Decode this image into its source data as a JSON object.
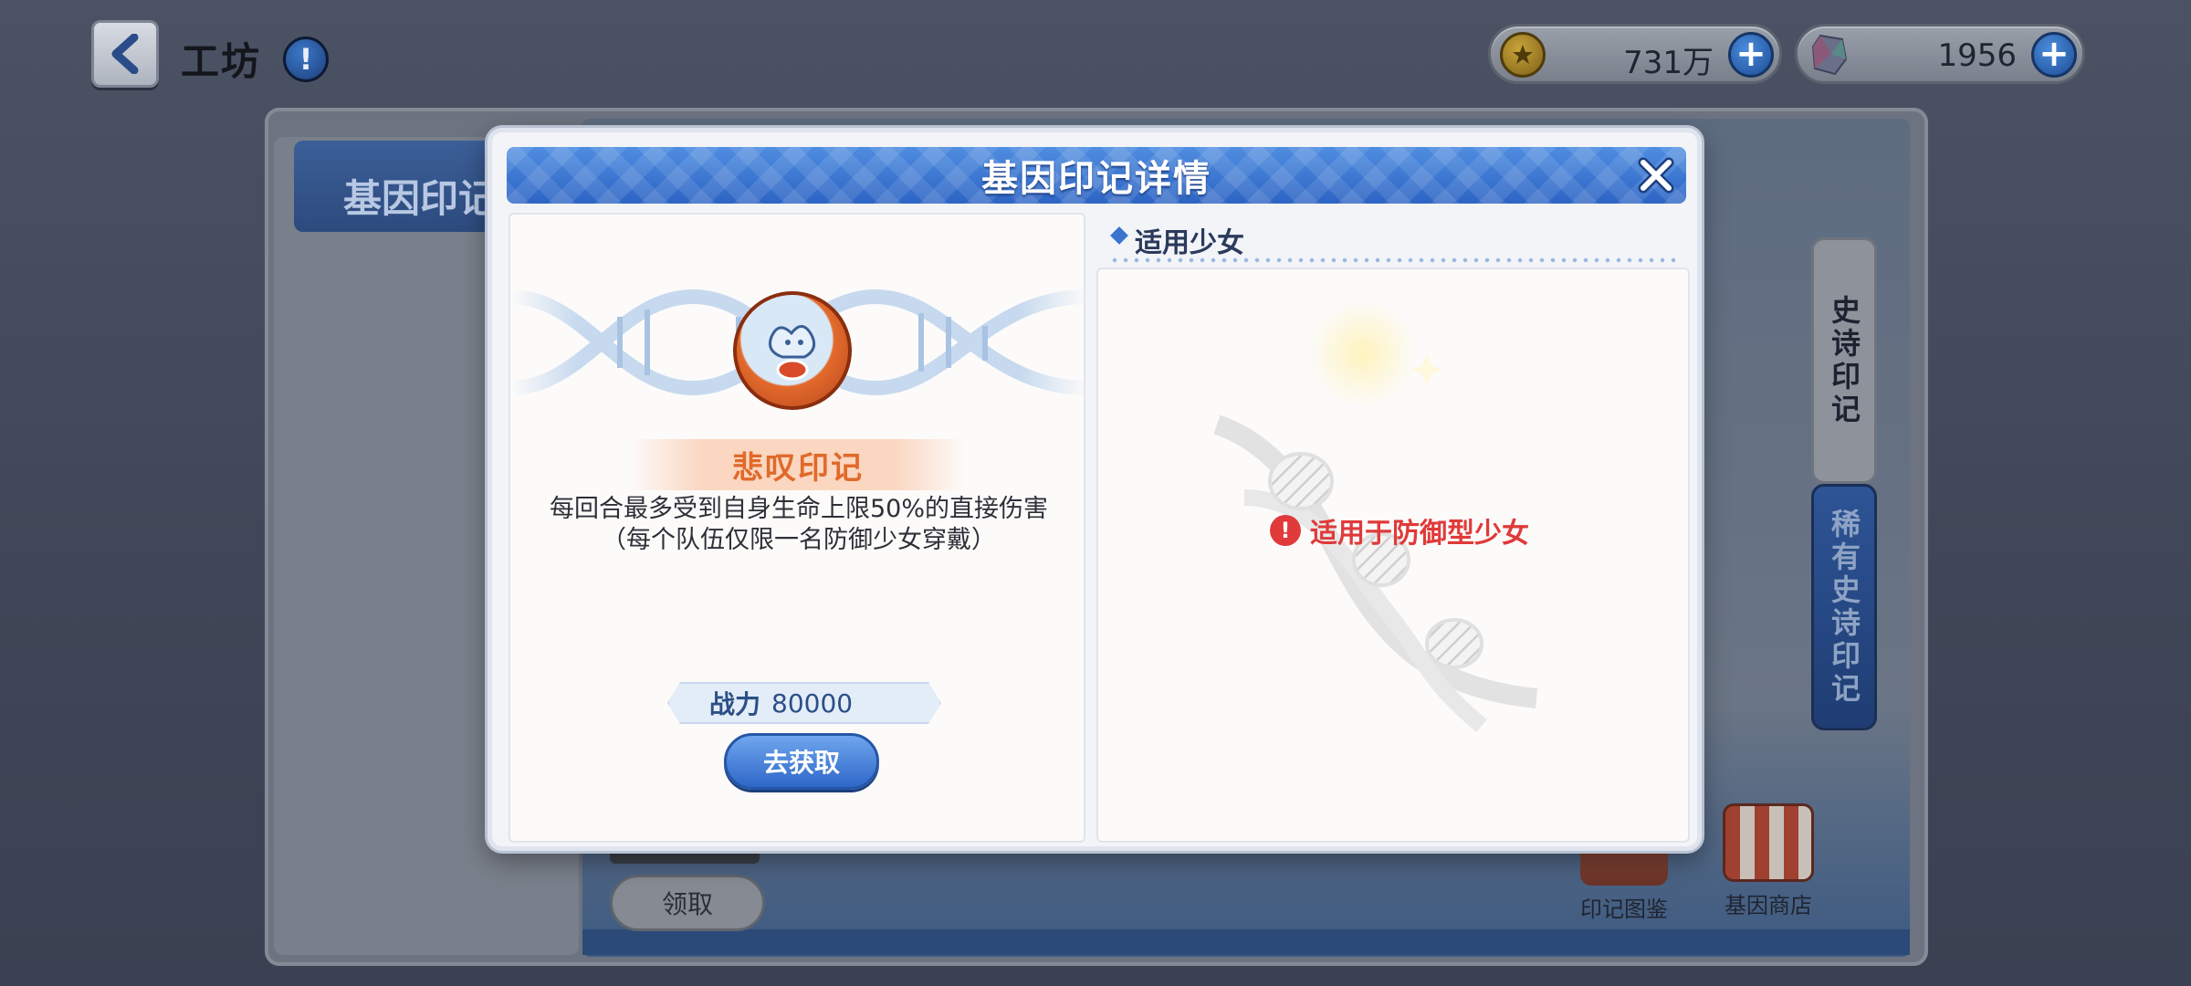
{
  "topbar": {
    "title": "工坊",
    "info_icon": "info-icon",
    "back_icon": "chevron-left-icon",
    "currencies": [
      {
        "name": "gold",
        "icon": "gold-coin-icon",
        "value": "731万"
      },
      {
        "name": "crystal",
        "icon": "crystal-icon",
        "value": "1956"
      }
    ]
  },
  "background": {
    "tab_label": "基因印记",
    "side_tabs": [
      "史诗印记",
      "稀有史诗印记"
    ],
    "claim_label": "领取",
    "shortcuts": [
      {
        "label": "印记图鉴",
        "icon": "imprint-book-icon"
      },
      {
        "label": "基因商店",
        "icon": "shop-icon"
      }
    ]
  },
  "modal": {
    "title": "基因印记详情",
    "close_icon": "close-icon",
    "imprint": {
      "name": "悲叹印记",
      "description": "每回合最多受到自身生命上限50%的直接伤害（每个队伍仅限一名防御少女穿戴）",
      "power_label": "战力",
      "power_value": "80000",
      "obtain_label": "去获取"
    },
    "applicable": {
      "section_title": "适用少女",
      "note": "适用于防御型少女"
    }
  },
  "colors": {
    "accent_blue": "#2d64c4",
    "imprint_orange": "#e06a2a",
    "warning_red": "#e03a3a"
  }
}
